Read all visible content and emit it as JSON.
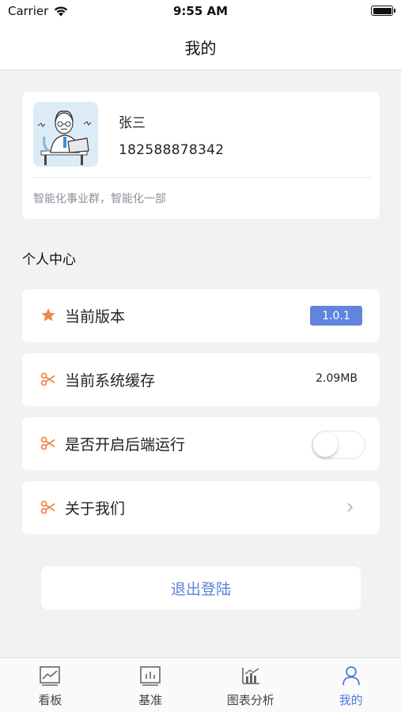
{
  "status_bar": {
    "carrier": "Carrier",
    "time": "9:55 AM"
  },
  "nav": {
    "title": "我的"
  },
  "profile": {
    "name": "张三",
    "phone": "182588878342",
    "department": "智能化事业群，智能化一部"
  },
  "section": {
    "title": "个人中心"
  },
  "menu": {
    "version": {
      "label": "当前版本",
      "value": "1.0.1",
      "icon": "star-icon"
    },
    "cache": {
      "label": "当前系统缓存",
      "value": "2.09MB",
      "icon": "scissors-icon"
    },
    "background_run": {
      "label": "是否开启后端运行",
      "enabled": false,
      "icon": "scissors-icon"
    },
    "about": {
      "label": "关于我们",
      "icon": "scissors-icon"
    }
  },
  "logout": {
    "label": "退出登陆"
  },
  "tabs": [
    {
      "label": "看板",
      "icon": "line-chart-icon",
      "active": false
    },
    {
      "label": "基准",
      "icon": "bar-chart-icon",
      "active": false
    },
    {
      "label": "图表分析",
      "icon": "chart-analysis-icon",
      "active": false
    },
    {
      "label": "我的",
      "icon": "user-icon",
      "active": true
    }
  ],
  "colors": {
    "accent": "#6184dd",
    "icon_orange": "#f08a4b",
    "active_tab": "#4d7ddc",
    "background": "#f1f2f4"
  }
}
